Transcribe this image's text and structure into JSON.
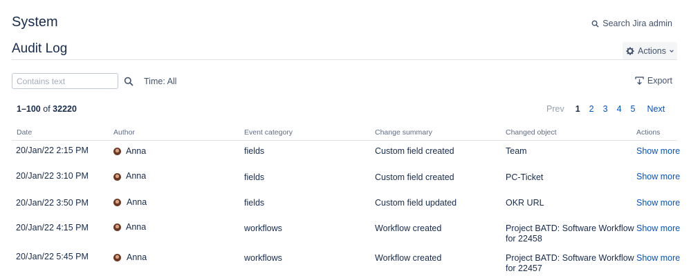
{
  "header": {
    "section_title": "System",
    "search_label": "Search Jira admin",
    "page_title": "Audit Log",
    "actions_label": "Actions"
  },
  "filters": {
    "search_placeholder": "Contains text",
    "search_value": "",
    "time_label": "Time: All",
    "export_label": "Export"
  },
  "results": {
    "range": "1–100",
    "of": "of",
    "total": "32220"
  },
  "pagination": {
    "prev": "Prev",
    "pages": [
      "1",
      "2",
      "3",
      "4",
      "5"
    ],
    "current": "1",
    "next": "Next"
  },
  "table": {
    "columns": [
      "Date",
      "Author",
      "Event category",
      "Change summary",
      "Changed object",
      "Actions"
    ],
    "rows": [
      {
        "date": "20/Jan/22 2:15 PM",
        "author": "Anna",
        "category": "fields",
        "summary": "Custom field created",
        "object": [
          "Team"
        ],
        "action": "Show more"
      },
      {
        "date": "20/Jan/22 3:10 PM",
        "author": "Anna",
        "category": "fields",
        "summary": "Custom field created",
        "object": [
          "PC-Ticket"
        ],
        "action": "Show more"
      },
      {
        "date": "20/Jan/22 3:50 PM",
        "author": "Anna",
        "category": "fields",
        "summary": "Custom field updated",
        "object": [
          "OKR URL"
        ],
        "action": "Show more"
      },
      {
        "date": "20/Jan/22 4:15 PM",
        "author": "Anna",
        "category": "workflows",
        "summary": "Workflow created",
        "object": [
          "Project BATD: Software Workflow",
          "for 22458"
        ],
        "action": "Show more"
      },
      {
        "date": "20/Jan/22 5:45 PM",
        "author": "Anna",
        "category": "workflows",
        "summary": "Workflow created",
        "object": [
          "Project BATD: Software Workflow",
          "for 22457"
        ],
        "action": "Show more"
      }
    ]
  },
  "colors": {
    "link": "#0052cc",
    "text": "#172b4d",
    "muted": "#5e6c84",
    "button_bg": "#f4f5f7"
  }
}
